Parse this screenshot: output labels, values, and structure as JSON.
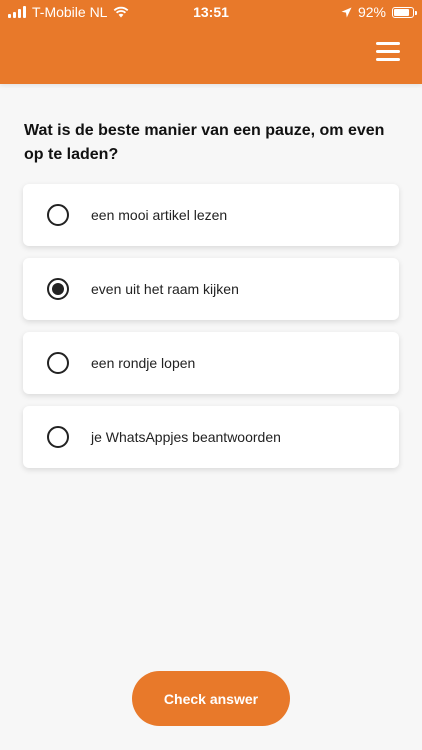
{
  "status_bar": {
    "carrier": "T-Mobile NL",
    "time": "13:51",
    "battery": "92%",
    "battery_level": 0.92
  },
  "header": {
    "menu_icon": "hamburger-menu-icon"
  },
  "quiz": {
    "question": "Wat is de beste manier van een pauze, om even op te laden?",
    "options": [
      {
        "label": "een mooi artikel lezen",
        "selected": false
      },
      {
        "label": "even uit het raam kijken",
        "selected": true
      },
      {
        "label": "een rondje lopen",
        "selected": false
      },
      {
        "label": "je WhatsAppjes beantwoorden",
        "selected": false
      }
    ],
    "check_label": "Check answer"
  },
  "colors": {
    "accent": "#e8792a",
    "background": "#f7f7f7"
  }
}
